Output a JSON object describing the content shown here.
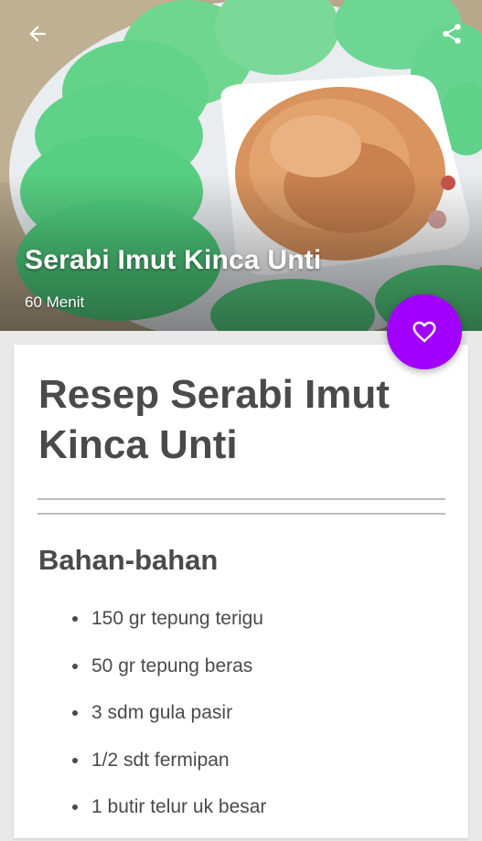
{
  "header": {
    "title": "Serabi Imut Kinca Unti",
    "duration": "60 Menit",
    "back_icon": "arrow-left",
    "share_icon": "share",
    "favorite_icon": "heart-outline",
    "favorite_color": "#a100ff"
  },
  "content": {
    "recipe_title": "Resep Serabi Imut Kinca Unti",
    "ingredients_heading": "Bahan-bahan",
    "ingredients": [
      "150 gr tepung terigu",
      "50 gr tepung beras",
      "3 sdm gula pasir",
      "1/2 sdt fermipan",
      "1 butir telur uk besar"
    ]
  }
}
